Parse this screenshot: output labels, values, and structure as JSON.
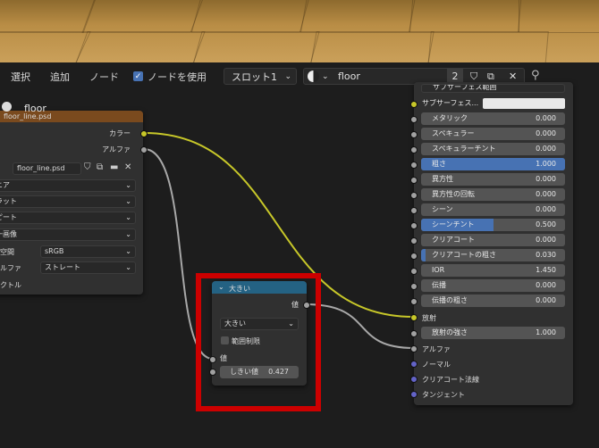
{
  "header": {
    "menus": [
      "選択",
      "追加",
      "ノード"
    ],
    "use_nodes_label": "ノードを使用",
    "slot_label": "スロット1",
    "material_name": "floor",
    "user_count": "2"
  },
  "image_node": {
    "title": "floor",
    "subtitle": "floor_line.psd",
    "outputs": [
      "カラー",
      "アルファ"
    ],
    "image_file": "floor_line.psd",
    "interpolation": "ニア",
    "projection": "ラット",
    "extension": "ピート",
    "source": "一画像",
    "color_space_label": "空間",
    "color_space": "sRGB",
    "alpha_label": "ルファ",
    "alpha_mode": "ストレート",
    "vector_label": "クトル"
  },
  "math_node": {
    "title": "大きい",
    "output": "値",
    "operation": "大きい",
    "clamp_label": "範囲制限",
    "input_label": "値",
    "threshold_label": "しきい値",
    "threshold_value": "0.427"
  },
  "bsdf_node": {
    "top_cut": "サブサーフェス範囲",
    "rows": [
      {
        "name": "サブサーフェス...",
        "value": ""
      },
      {
        "name": "メタリック",
        "value": "0.000"
      },
      {
        "name": "スペキュラー",
        "value": "0.000"
      },
      {
        "name": "スペキュラーチント",
        "value": "0.000"
      },
      {
        "name": "粗さ",
        "value": "1.000"
      },
      {
        "name": "異方性",
        "value": "0.000"
      },
      {
        "name": "異方性の回転",
        "value": "0.000"
      },
      {
        "name": "シーン",
        "value": "0.000"
      },
      {
        "name": "シーンチント",
        "value": "0.500"
      },
      {
        "name": "クリアコート",
        "value": "0.000"
      },
      {
        "name": "クリアコートの粗さ",
        "value": "0.030"
      },
      {
        "name": "IOR",
        "value": "1.450"
      },
      {
        "name": "伝播",
        "value": "0.000"
      },
      {
        "name": "伝播の粗さ",
        "value": "0.000"
      }
    ],
    "emission_label": "放射",
    "emission_strength": {
      "name": "放射の強さ",
      "value": "1.000"
    },
    "alpha_label": "アルファ",
    "normal_label": "ノーマル",
    "clearcoat_normal_label": "クリアコート法線",
    "tangent_label": "タンジェント"
  },
  "colors": {
    "accent": "#4772b3",
    "image_header": "#7a4a1e",
    "converter_header": "#246283",
    "highlight": "#cc0000",
    "wire_color": "#c7c729"
  }
}
